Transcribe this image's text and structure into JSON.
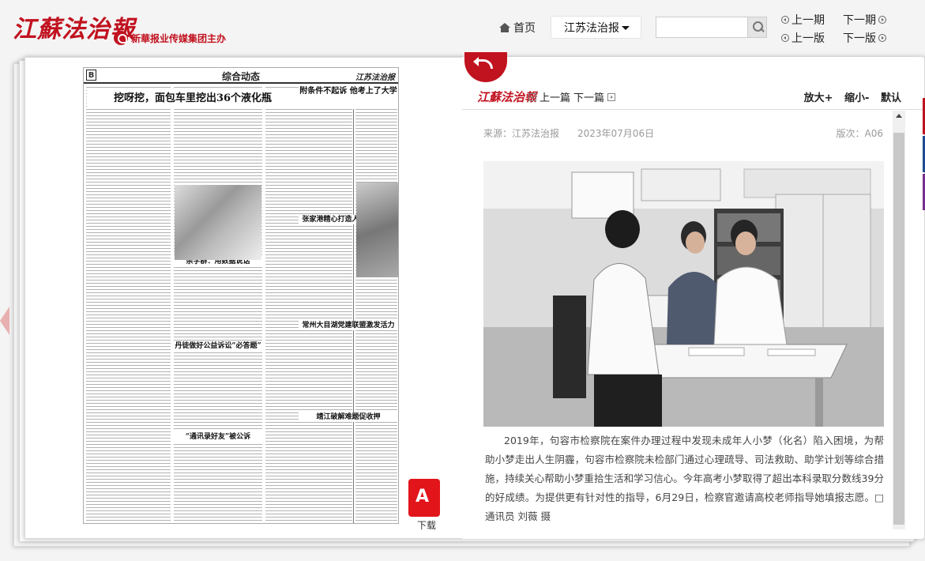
{
  "header": {
    "logo_text": "江蘇法治報",
    "group_text": "新華报业传媒集团主办",
    "home_label": "首页",
    "paper_select": "江苏法治报",
    "search_placeholder": "",
    "prev_issue": "上一期",
    "next_issue": "下一期",
    "prev_page": "上一版",
    "next_page": "下一版"
  },
  "newspaper": {
    "page_letter": "B",
    "section": "综合动态",
    "masthead": "江苏法治报",
    "headlines": [
      "挖呀挖，面包车里挖出36个液化瓶",
      "附条件不起诉 他考上了大学",
      "张家港精心打造人才培养品牌",
      "常州大目湖党建联盟激发活力",
      "靖江破解难题促收押",
      "杀学群：用数据说话",
      "丹徒做好公益诉讼“必答题”",
      "“通讯录好友”被公诉"
    ],
    "download_label": "下载"
  },
  "article": {
    "mini_logo": "江蘇法治報",
    "prev_article": "上一篇",
    "next_article": "下一篇",
    "zoom_in": "放大+",
    "zoom_out": "缩小-",
    "zoom_default": "默认",
    "source": "来源：江苏法治报",
    "date": "2023年07月06日",
    "edition": "版次：A06",
    "caption": "2019年，句容市检察院在案件办理过程中发现未成年人小梦（化名）陷入困境，为帮助小梦走出人生阴霾，句容市检察院未检部门通过心理疏导、司法救助、助学计划等综合措施，持续关心帮助小梦重拾生活和学习信心。今年高考小梦取得了超出本科录取分数线39分的好成绩。为提供更有针对性的指导，6月29日，检察官邀请高校老师指导她填报志愿。□通讯员 刘薇 摄"
  },
  "colors": {
    "brand_red": "#c1121f",
    "pdf_red": "#e2151b",
    "right_edge_accents": [
      "#c1121f",
      "#1d4f91",
      "#7a2e8e",
      "#e87722"
    ]
  }
}
